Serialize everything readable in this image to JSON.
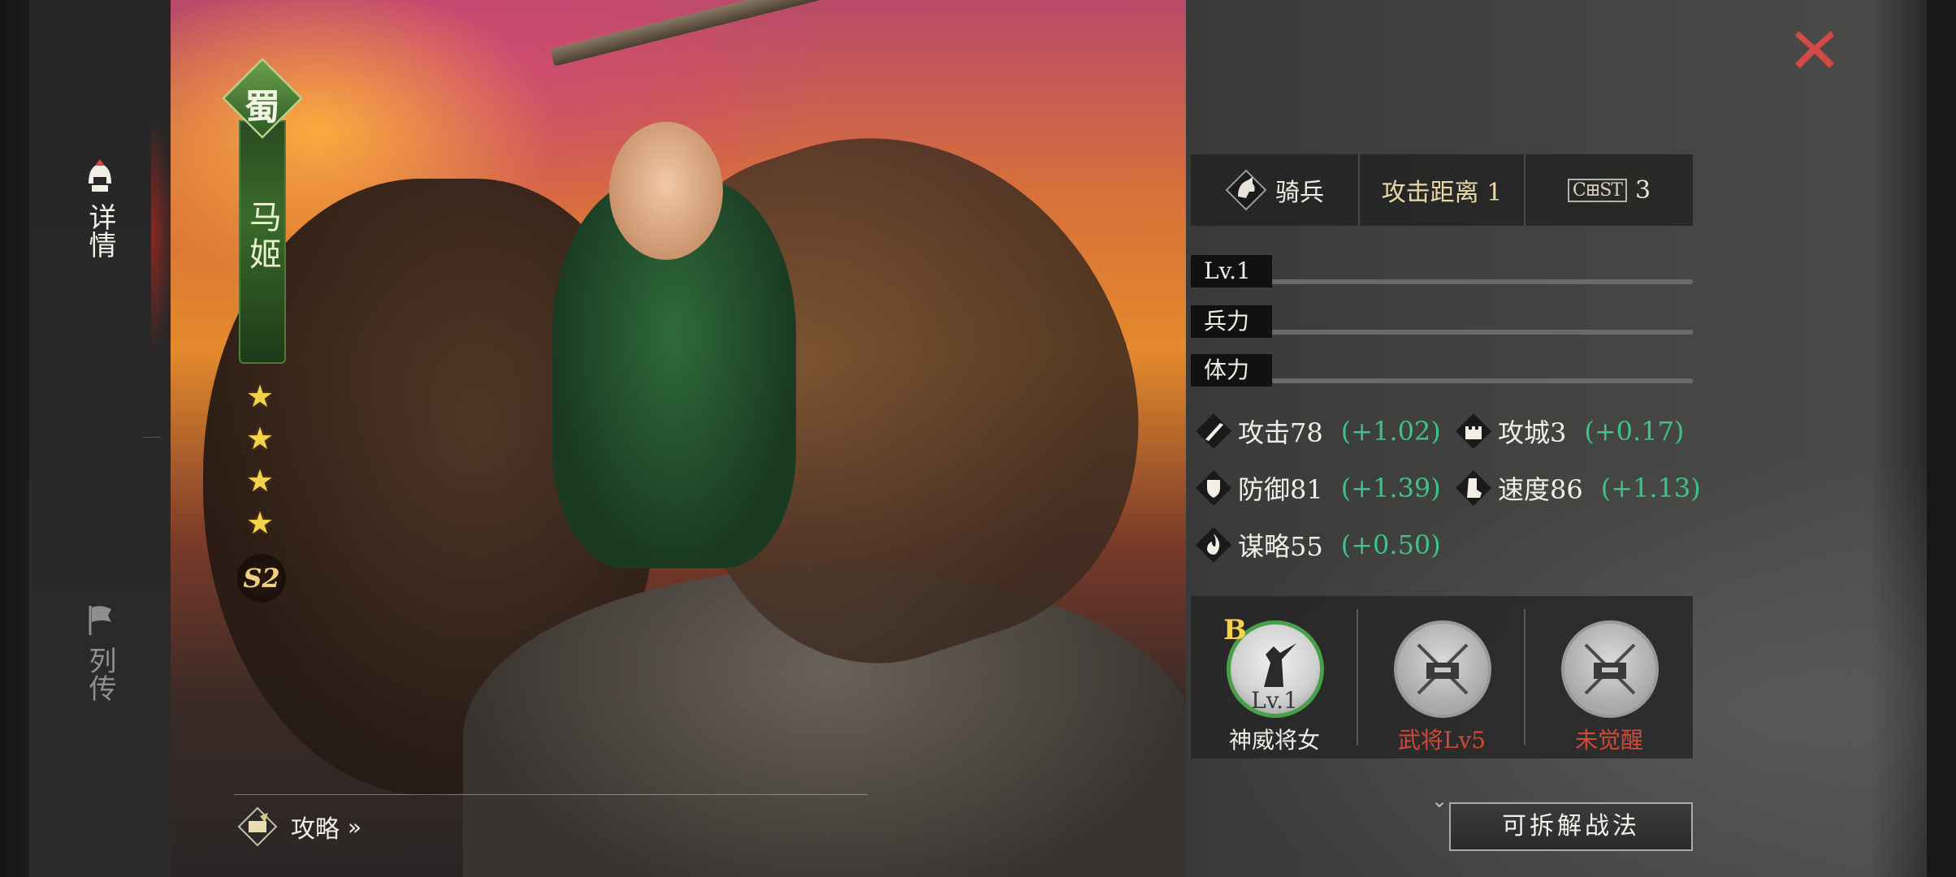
{
  "sidebar": {
    "tabs": [
      {
        "label": "详情",
        "icon": "helmet-icon",
        "active": true
      },
      {
        "label": "列传",
        "icon": "flag-icon",
        "active": false
      }
    ]
  },
  "hero": {
    "faction": "蜀",
    "name": "马姬",
    "stars": [
      "★",
      "★",
      "★",
      "★"
    ],
    "season": "S2"
  },
  "guide": {
    "label": "攻略",
    "arrow": "»",
    "icon": "strategy-book-icon"
  },
  "info_bar": {
    "unit_type": "骑兵",
    "attack_range": "攻击距离 1",
    "cost_icon_text": "C⊞ST",
    "cost": "3"
  },
  "bars": [
    {
      "label": "Lv.1"
    },
    {
      "label": "兵力"
    },
    {
      "label": "体力"
    }
  ],
  "stats": {
    "attack": {
      "value": "攻击78",
      "delta": "(+1.02)"
    },
    "siege": {
      "value": "攻城3",
      "delta": "(+0.17)"
    },
    "defense": {
      "value": "防御81",
      "delta": "(+1.39)"
    },
    "speed": {
      "value": "速度86",
      "delta": "(+1.13)"
    },
    "strategy": {
      "value": "谋略55",
      "delta": "(+0.50)"
    }
  },
  "skills": [
    {
      "grade": "B",
      "level": "Lv.1",
      "name": "神威将女",
      "state": "open"
    },
    {
      "name": "武将Lv5",
      "state": "locked"
    },
    {
      "name": "未觉醒",
      "state": "locked"
    }
  ],
  "actions": {
    "decompose": "可拆解战法"
  },
  "colors": {
    "accent_green": "#3ec28a",
    "locked_red": "#d04a3a",
    "close_red": "#d24a44",
    "star_gold": "#f4d24a"
  }
}
